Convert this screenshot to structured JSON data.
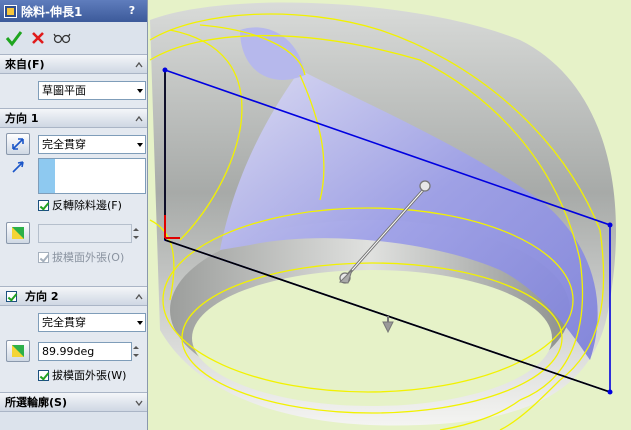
{
  "window": {
    "title": "除料-伸長1",
    "help": "?"
  },
  "actions": {
    "ok": "ok-check-icon",
    "cancel": "cancel-x-icon",
    "preview": "preview-glasses-icon"
  },
  "from": {
    "header": "來自(F)",
    "value": "草圖平面"
  },
  "direction1": {
    "header": "方向 1",
    "end_condition": "完全貫穿",
    "flip_side_label": "反轉除料邊(F)",
    "flip_side_checked": true,
    "draft_angle": "",
    "draft_outward_label": "拔模面外張(O)",
    "draft_outward_checked": true
  },
  "direction2": {
    "header": "方向 2",
    "enabled": true,
    "end_condition": "完全貫穿",
    "draft_angle": "89.99deg",
    "draft_outward_label": "拔模面外張(W)",
    "draft_outward_checked": true
  },
  "selected_contours": {
    "header": "所選輪廓(S)"
  },
  "colors": {
    "viewport_bg": "#e6f2c8",
    "title_bar": "#4b69a8",
    "sketch_plane": "#0000e0",
    "edges": "#f2f200"
  }
}
